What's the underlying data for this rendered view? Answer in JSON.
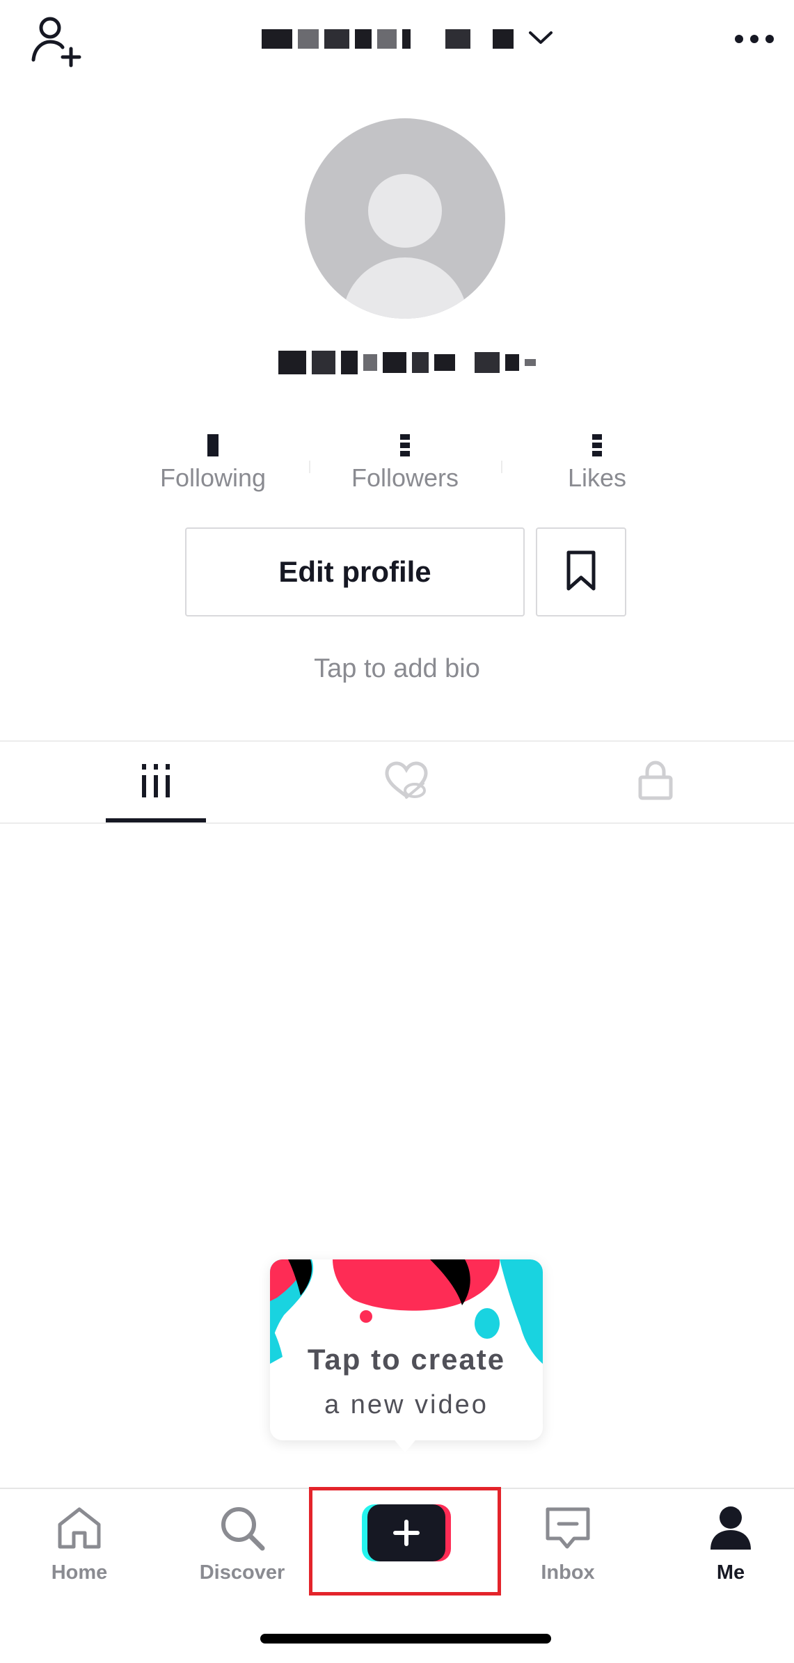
{
  "stats": [
    {
      "value": "",
      "label": "Following"
    },
    {
      "value": "",
      "label": "Followers"
    },
    {
      "value": "",
      "label": "Likes"
    }
  ],
  "profile": {
    "edit_label": "Edit profile",
    "bio_placeholder": "Tap to add bio"
  },
  "tooltip": {
    "line1": "Tap to create",
    "line2": "a new video"
  },
  "nav": {
    "home": "Home",
    "discover": "Discover",
    "inbox": "Inbox",
    "me": "Me"
  },
  "colors": {
    "accent_red": "#FE2C55",
    "accent_cyan": "#25F4EE",
    "text_dark": "#161823",
    "text_muted": "#8A8B91",
    "highlight_box": "#E3242B"
  },
  "icons": {
    "top_left": "add-user-icon",
    "title_dropdown": "chevron-down-icon",
    "top_right": "more-icon",
    "bookmark": "bookmark-icon",
    "tab_videos": "grid-icon",
    "tab_liked": "liked-hidden-icon",
    "tab_private": "lock-icon",
    "nav_home": "home-icon",
    "nav_discover": "search-icon",
    "nav_create": "plus-icon",
    "nav_inbox": "inbox-icon",
    "nav_me": "person-icon"
  }
}
